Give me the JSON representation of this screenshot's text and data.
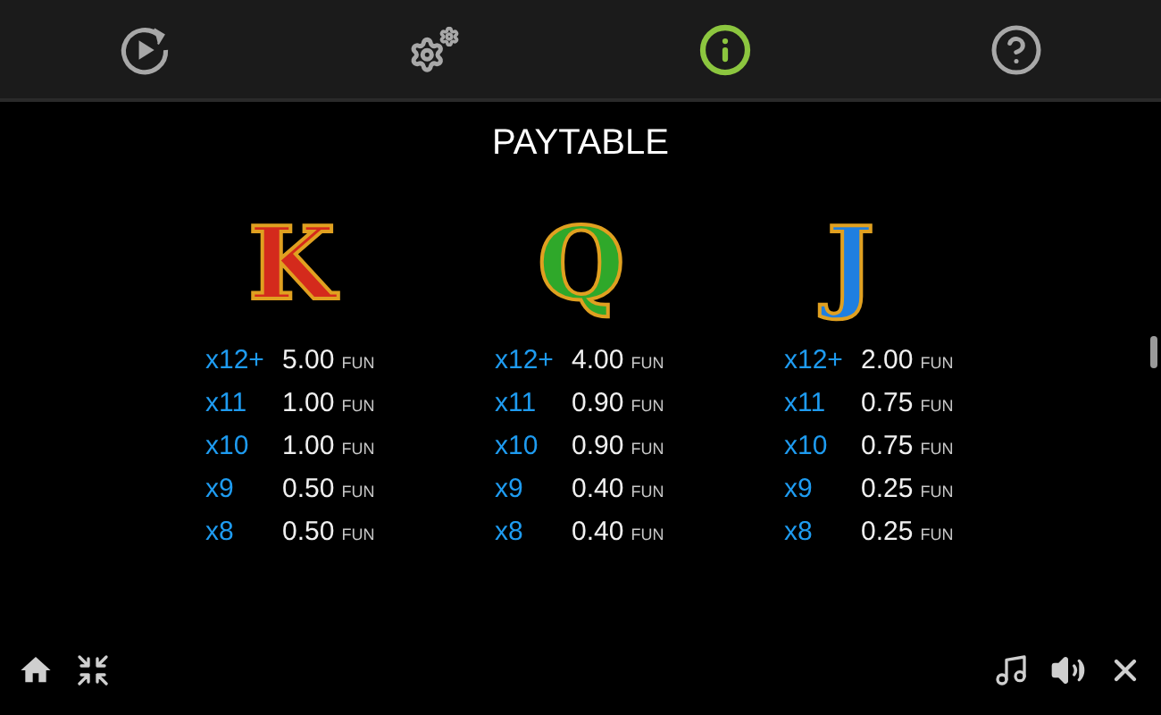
{
  "tabs": [
    {
      "kind": "replay",
      "selected": false
    },
    {
      "kind": "settings",
      "selected": false
    },
    {
      "kind": "info",
      "selected": true
    },
    {
      "kind": "help",
      "selected": false
    }
  ],
  "title": "PAYTABLE",
  "symbols": [
    {
      "symbol": "K",
      "color": "#d42a1c",
      "rows": [
        {
          "count": "x12+",
          "value": "5.00",
          "currency": "FUN"
        },
        {
          "count": "x11",
          "value": "1.00",
          "currency": "FUN"
        },
        {
          "count": "x10",
          "value": "1.00",
          "currency": "FUN"
        },
        {
          "count": "x9",
          "value": "0.50",
          "currency": "FUN"
        },
        {
          "count": "x8",
          "value": "0.50",
          "currency": "FUN"
        }
      ]
    },
    {
      "symbol": "Q",
      "color": "#2fa82a",
      "rows": [
        {
          "count": "x12+",
          "value": "4.00",
          "currency": "FUN"
        },
        {
          "count": "x11",
          "value": "0.90",
          "currency": "FUN"
        },
        {
          "count": "x10",
          "value": "0.90",
          "currency": "FUN"
        },
        {
          "count": "x9",
          "value": "0.40",
          "currency": "FUN"
        },
        {
          "count": "x8",
          "value": "0.40",
          "currency": "FUN"
        }
      ]
    },
    {
      "symbol": "J",
      "color": "#1f7fe0",
      "rows": [
        {
          "count": "x12+",
          "value": "2.00",
          "currency": "FUN"
        },
        {
          "count": "x11",
          "value": "0.75",
          "currency": "FUN"
        },
        {
          "count": "x10",
          "value": "0.75",
          "currency": "FUN"
        },
        {
          "count": "x9",
          "value": "0.25",
          "currency": "FUN"
        },
        {
          "count": "x8",
          "value": "0.25",
          "currency": "FUN"
        }
      ]
    }
  ],
  "left_controls": [
    {
      "kind": "home"
    },
    {
      "kind": "minimize"
    }
  ],
  "right_controls": [
    {
      "kind": "music"
    },
    {
      "kind": "sound"
    },
    {
      "kind": "close"
    }
  ]
}
